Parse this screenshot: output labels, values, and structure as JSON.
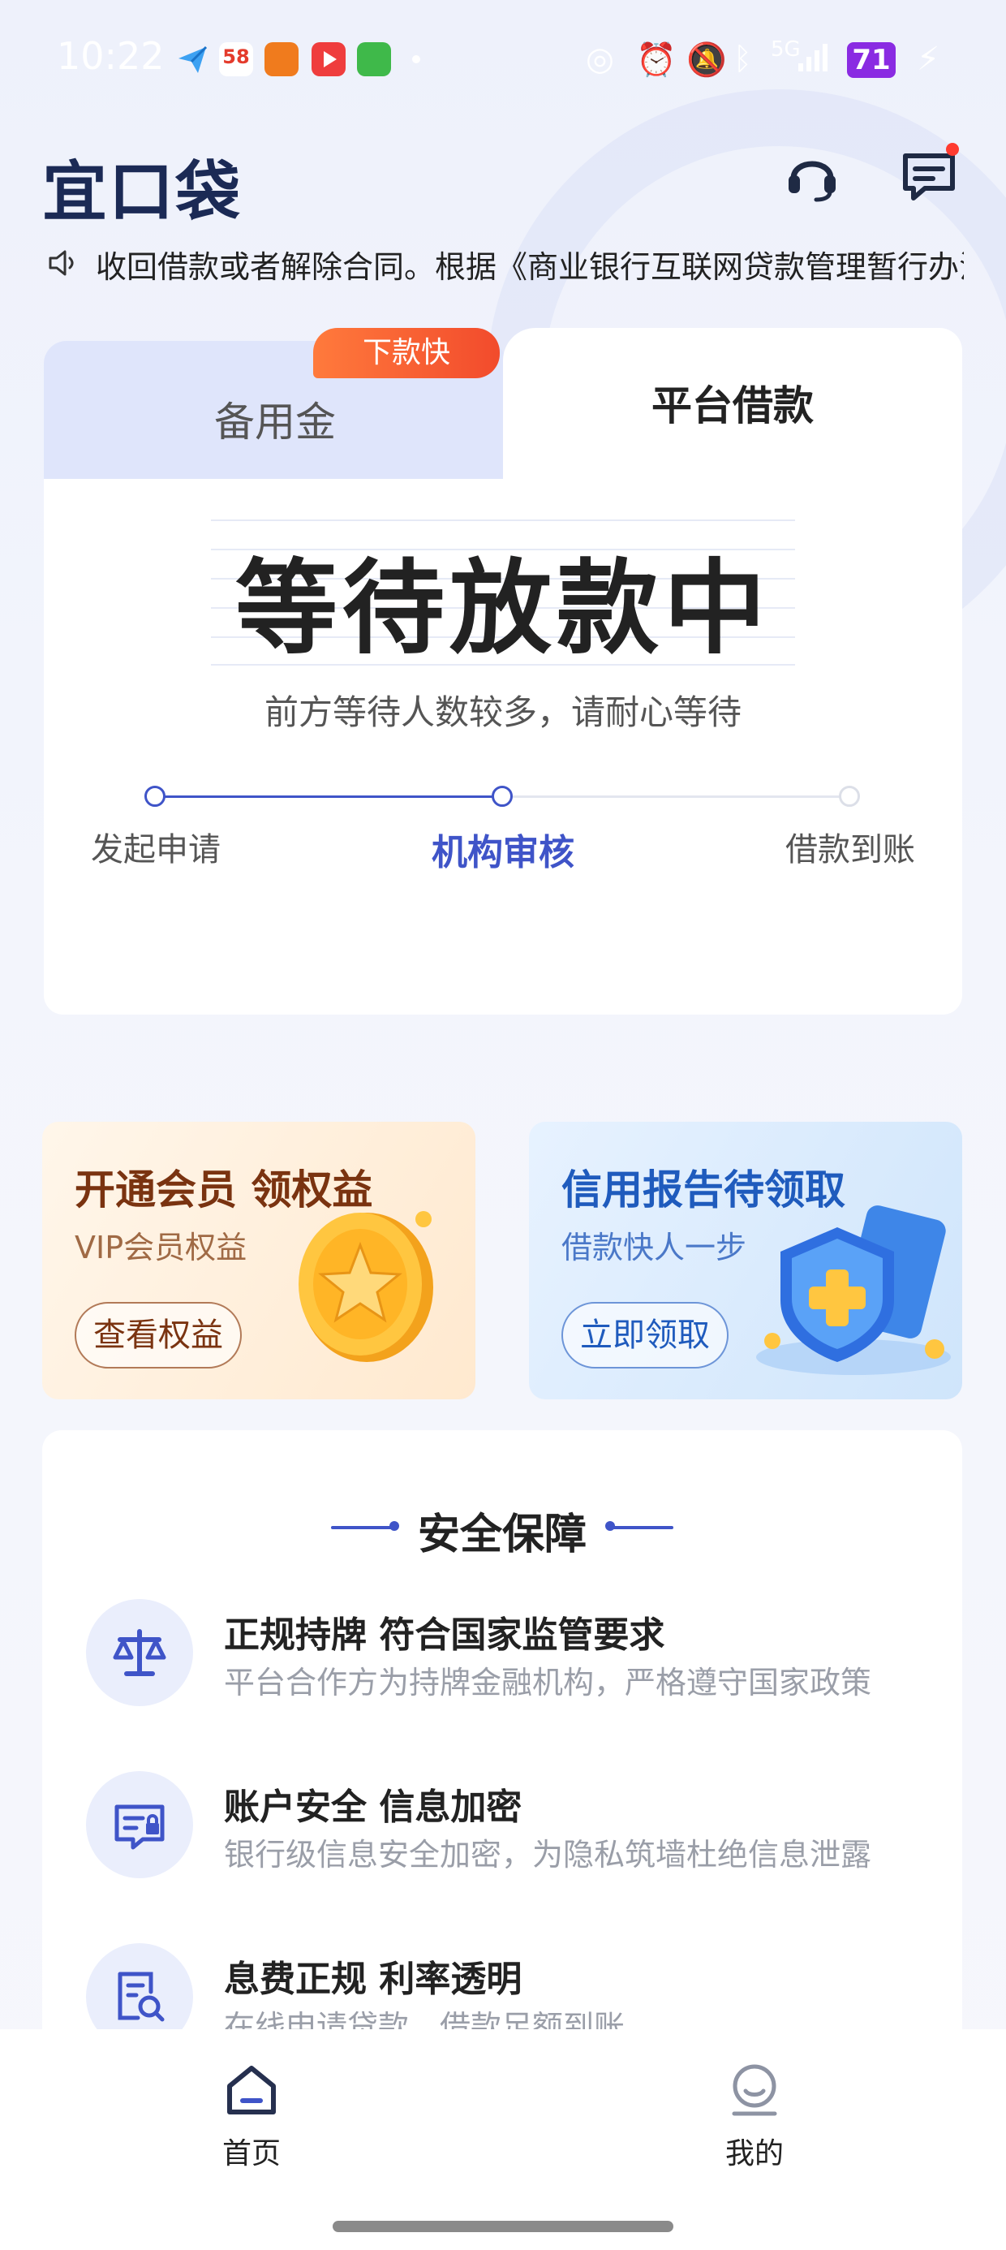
{
  "status_bar": {
    "time": "10:22",
    "app_58_label": "58",
    "signal_label": "5G",
    "battery_level": "71",
    "icons": [
      "send-icon",
      "app-58-icon",
      "app-tv-icon",
      "app-video-icon",
      "app-chat-icon",
      "dot-icon",
      "nfc-icon",
      "alarm-icon",
      "mute-icon",
      "bluetooth-icon",
      "signal-icon",
      "battery-icon",
      "charging-icon"
    ]
  },
  "header": {
    "logo": "宜口袋",
    "buttons": [
      "headset-icon",
      "message-icon"
    ]
  },
  "notice": {
    "text": "收回借款或者解除合同。根据《商业银行互联网贷款管理暂行办法》"
  },
  "loan_card": {
    "tabs": [
      {
        "label": "备用金",
        "selected": false
      },
      {
        "label": "平台借款",
        "selected": true
      }
    ],
    "badge": "下款快",
    "status_title": "等待放款中",
    "status_subtitle": "前方等待人数较多，请耐心等待",
    "steps": [
      {
        "label": "发起申请",
        "state": "done"
      },
      {
        "label": "机构审核",
        "state": "current"
      },
      {
        "label": "借款到账",
        "state": "pending"
      }
    ],
    "progress_fraction": 0.5
  },
  "promos": {
    "vip": {
      "title": "开通会员 领权益",
      "subtitle": "VIP会员权益",
      "button": "查看权益"
    },
    "credit": {
      "title": "信用报告待领取",
      "subtitle": "借款快人一步",
      "button": "立即领取"
    }
  },
  "safety": {
    "title": "安全保障",
    "items": [
      {
        "icon": "scale-icon",
        "head": "正规持牌 符合国家监管要求",
        "desc": "平台合作方为持牌金融机构，严格遵守国家政策"
      },
      {
        "icon": "id-card-icon",
        "head": "账户安全 信息加密",
        "desc": "银行级信息安全加密，为隐私筑墙杜绝信息泄露"
      },
      {
        "icon": "doc-search-icon",
        "head": "息费正规  利率透明",
        "desc": "在线申请贷款，借款足额到账"
      }
    ]
  },
  "bottom_nav": {
    "items": [
      {
        "label": "首页",
        "icon": "home-icon",
        "selected": true
      },
      {
        "label": "我的",
        "icon": "profile-icon",
        "selected": false
      }
    ]
  },
  "colors": {
    "accent": "#3f54c8",
    "badge": "#f24b2c",
    "tab_inactive_bg": "#dfe5fb"
  }
}
